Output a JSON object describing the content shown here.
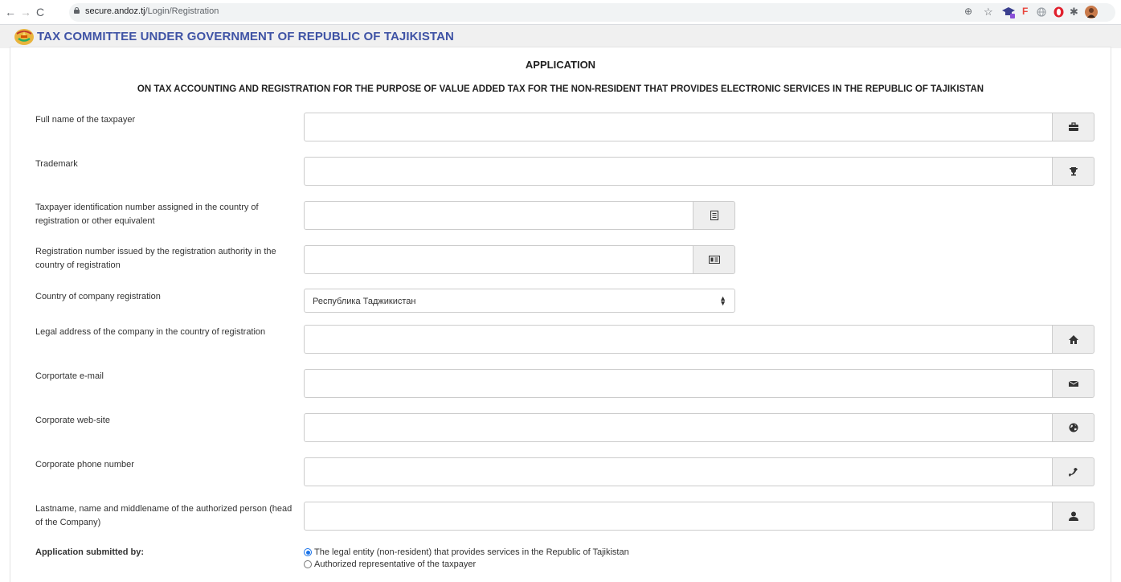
{
  "browser": {
    "url_host": "secure.andoz.tj",
    "url_path": "/Login/Registration"
  },
  "header": {
    "title": "TAX COMMITTEE UNDER GOVERNMENT OF REPUBLIC OF TAJIKISTAN"
  },
  "form": {
    "title": "APPLICATION",
    "subtitle": "ON TAX ACCOUNTING AND REGISTRATION FOR THE PURPOSE OF VALUE ADDED TAX FOR THE NON-RESIDENT THAT PROVIDES ELECTRONIC SERVICES IN THE REPUBLIC OF TAJIKISTAN",
    "fields": {
      "full_name": {
        "label": "Full name of the taxpayer",
        "value": "",
        "icon": "briefcase-icon"
      },
      "trademark": {
        "label": "Trademark",
        "value": "",
        "icon": "trophy-icon"
      },
      "tin": {
        "label": "Taxpayer identification number assigned in the country of registration or other equivalent",
        "value": "",
        "icon": "list-icon"
      },
      "reg_number": {
        "label": "Registration number issued by the registration authority in the country of registration",
        "value": "",
        "icon": "id-card-icon"
      },
      "country": {
        "label": "Country of company registration",
        "value": "Республика Таджикистан"
      },
      "legal_address": {
        "label": "Legal address of the company in the country of registration",
        "value": "",
        "icon": "home-icon"
      },
      "email": {
        "label": "Corportate e-mail",
        "value": "",
        "icon": "envelope-icon"
      },
      "website": {
        "label": "Corporate web-site",
        "value": "",
        "icon": "globe-icon"
      },
      "phone": {
        "label": "Corporate phone number",
        "value": "",
        "icon": "phone-icon"
      },
      "authorized_person": {
        "label": "Lastname, name and middlename of the authorized person (head of the Company)",
        "value": "",
        "icon": "user-icon"
      }
    },
    "submitted_by": {
      "label": "Application submitted by:",
      "options": [
        {
          "label": "The legal entity (non-resident) that provides services in the Republic of Tajikistan",
          "checked": true
        },
        {
          "label": "Authorized representative of the taxpayer",
          "checked": false
        }
      ]
    }
  },
  "colors": {
    "header_title": "#3f53a5",
    "header_bg": "#f0f0f0",
    "addon_bg": "#eeeeee",
    "radio_accent": "#1a73e8"
  }
}
